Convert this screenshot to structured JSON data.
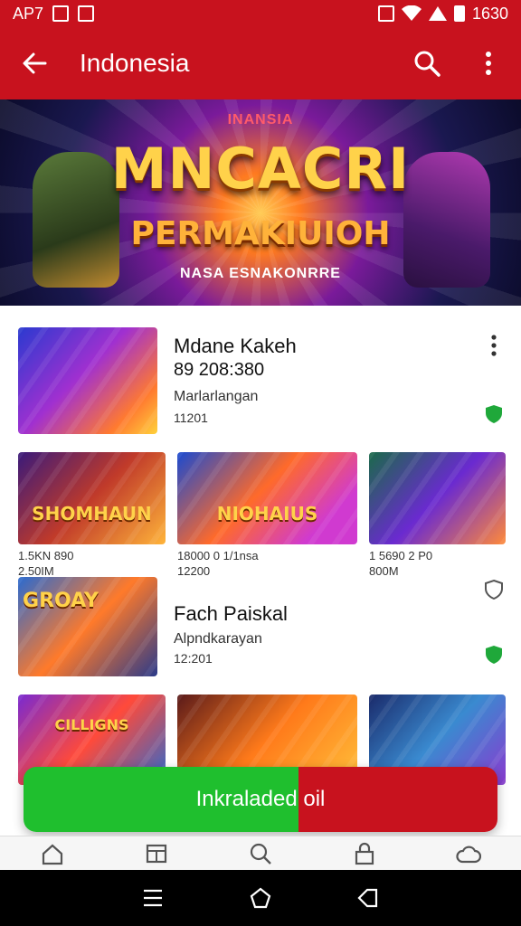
{
  "status_bar": {
    "left_text": "AP7",
    "time": "1630"
  },
  "app_bar": {
    "title": "Indonesia",
    "back_icon": "arrow-left-icon",
    "search_icon": "search-icon",
    "menu_icon": "more-vert-icon"
  },
  "banner": {
    "tag": "INANSIA",
    "title": "MNCACRI",
    "subtitle": "PERMAKIUIOH",
    "tagline": "NASA ESNAKONRRE"
  },
  "featured": [
    {
      "title": "Mdane Kakeh",
      "price": "89 208:380",
      "subtitle": "Marlarlangan",
      "meta": "11201",
      "status_color": "#1fa83a"
    },
    {
      "title": "Fach Paiskal",
      "price": "",
      "subtitle": "Alpndkarayan",
      "meta": "12:201",
      "status_color": "#1fa83a",
      "thumb_label": "GROAY"
    }
  ],
  "grid_row_1": [
    {
      "thumb_label": "SHOMHAUN",
      "line1": "1.5KN 890",
      "line2": "2.50IM"
    },
    {
      "thumb_label": "NIOHAIUS",
      "line1": "18000 0 1/1nsa",
      "line2": "12200"
    },
    {
      "thumb_label": "",
      "line1": "1 5690 2 P0",
      "line2": "800M"
    }
  ],
  "grid_row_2": [
    {
      "thumb_label": "CILLIGNS"
    },
    {
      "thumb_label": ""
    },
    {
      "thumb_label": ""
    }
  ],
  "install_button": {
    "label": "Inkraladed oil"
  },
  "bottom_nav": [
    "home-icon",
    "apps-icon",
    "search-icon",
    "lock-icon",
    "cloud-icon"
  ],
  "system_nav": [
    "recent-apps-icon",
    "home-circle-icon",
    "back-triangle-icon"
  ],
  "colors": {
    "primary_red": "#c8121e",
    "accent_green": "#1fbf2e"
  }
}
